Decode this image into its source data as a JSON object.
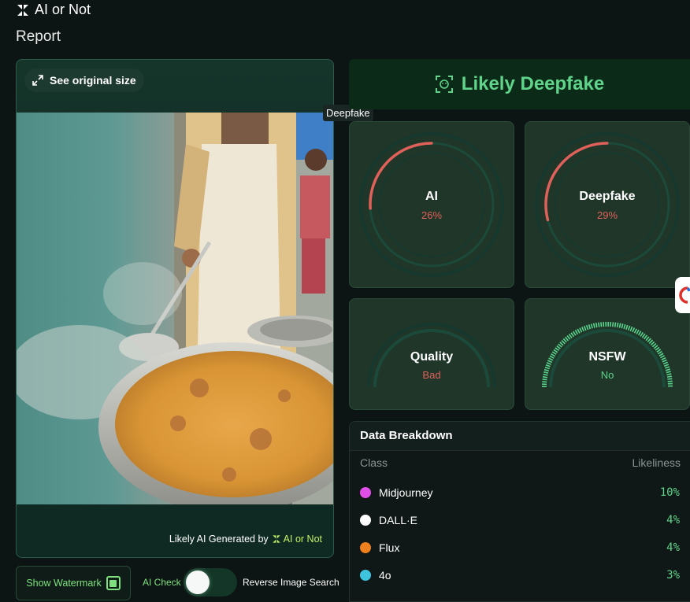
{
  "app": {
    "name": "AI or Not",
    "page_title": "Report"
  },
  "image_panel": {
    "see_original_label": "See original size",
    "watermark_prefix": "Likely AI Generated by",
    "watermark_brand": "AI or Not"
  },
  "tooltip": {
    "text": "Deepfake"
  },
  "verdict": {
    "label": "Likely Deepfake",
    "color": "#5fd48a",
    "icon": "face-scan-icon"
  },
  "gauges": [
    {
      "label": "AI",
      "value": "26%",
      "fraction": 0.26,
      "status_color": "#e0605a"
    },
    {
      "label": "Deepfake",
      "value": "29%",
      "fraction": 0.29,
      "status_color": "#e0605a"
    },
    {
      "label": "Quality",
      "value": "Bad",
      "fraction": 0.0,
      "status_color": "#e0605a"
    },
    {
      "label": "NSFW",
      "value": "No",
      "fraction": 1.0,
      "status_color": "#5fd48a"
    }
  ],
  "breakdown": {
    "title": "Data Breakdown",
    "col_class": "Class",
    "col_likeliness": "Likeliness",
    "rows": [
      {
        "name": "Midjourney",
        "value": "10%",
        "color": "#e04ee8"
      },
      {
        "name": "DALL·E",
        "value": "4%",
        "color": "#ffffff"
      },
      {
        "name": "Flux",
        "value": "4%",
        "color": "#f0801e"
      },
      {
        "name": "4o",
        "value": "3%",
        "color": "#3fc4e0"
      }
    ]
  },
  "controls": {
    "show_watermark_label": "Show Watermark",
    "ai_check_label": "AI Check",
    "reverse_search_label": "Reverse Image Search"
  }
}
